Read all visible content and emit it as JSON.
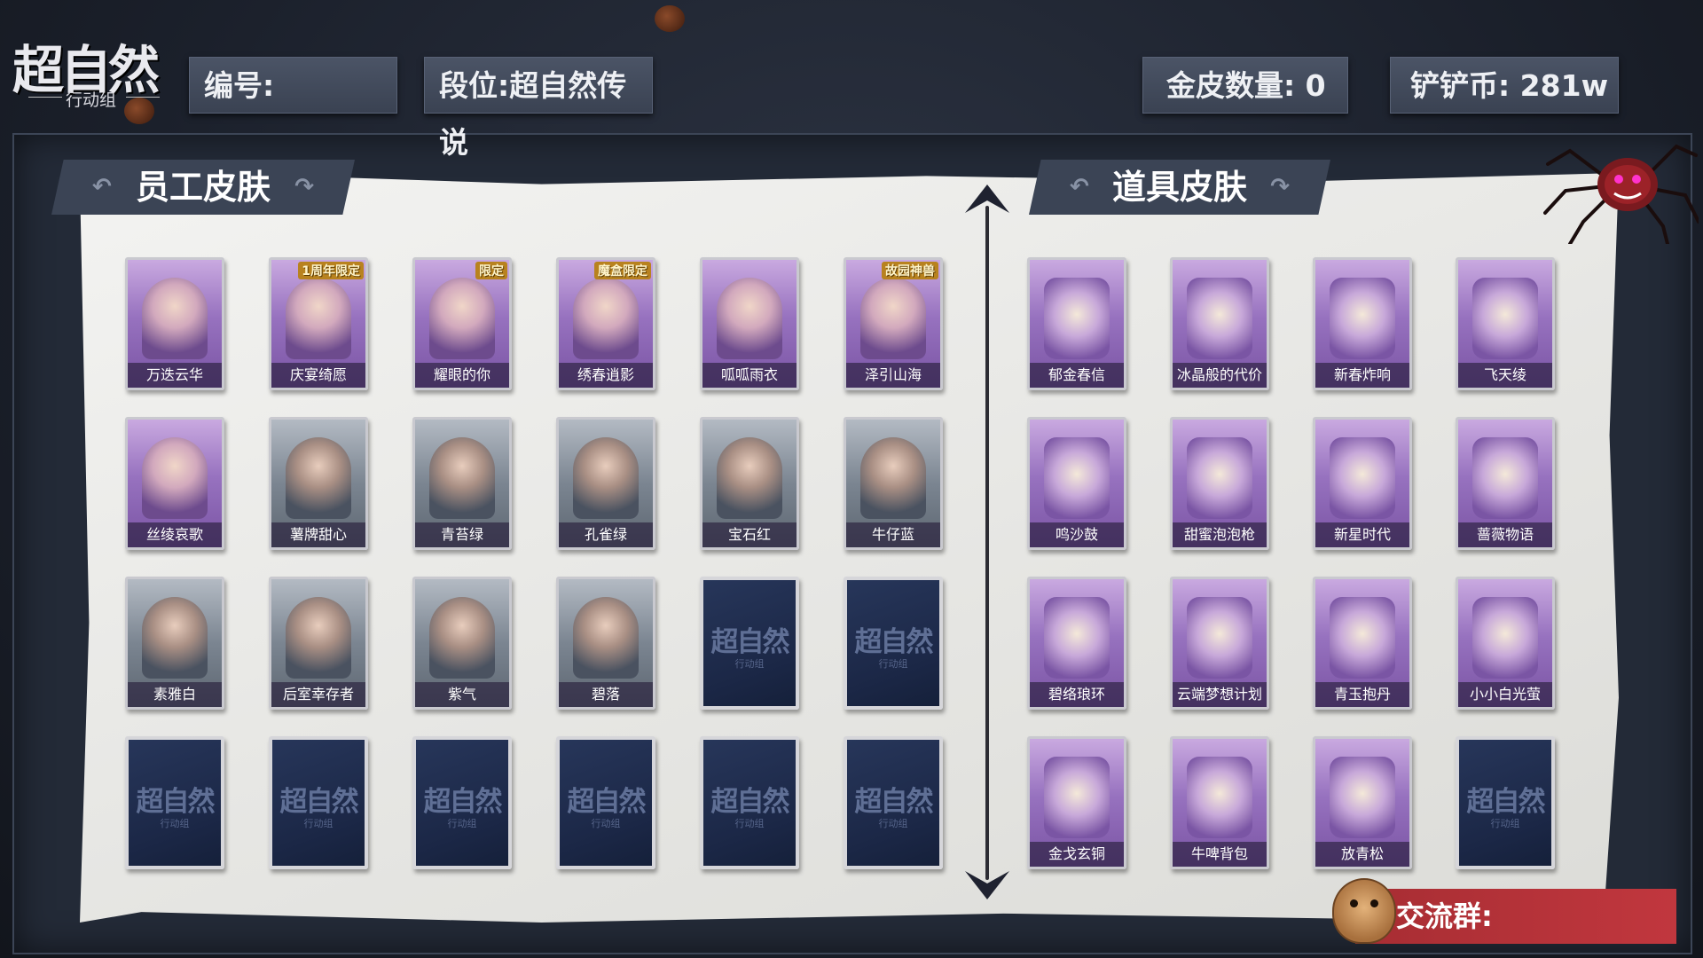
{
  "logo": {
    "main": "超自然",
    "sub": "行动组"
  },
  "stats": {
    "id_label": "编号:",
    "rank_label": "段位:超自然传说",
    "gold_label": "金皮数量: 0",
    "coin_label": "铲铲币: 281w"
  },
  "employee_section": {
    "title": "员工皮肤",
    "cards": [
      {
        "name": "万迭云华",
        "style": "purple",
        "badge": ""
      },
      {
        "name": "庆宴绮愿",
        "style": "purple",
        "badge": "1周年限定"
      },
      {
        "name": "耀眼的你",
        "style": "purple",
        "badge": "限定"
      },
      {
        "name": "绣春逍影",
        "style": "purple",
        "badge": "魔盒限定"
      },
      {
        "name": "呱呱雨衣",
        "style": "purple",
        "badge": ""
      },
      {
        "name": "泽引山海",
        "style": "purple",
        "badge": "故园神兽"
      },
      {
        "name": "丝绫哀歌",
        "style": "purple",
        "badge": ""
      },
      {
        "name": "薯牌甜心",
        "style": "gray",
        "badge": ""
      },
      {
        "name": "青苔绿",
        "style": "gray",
        "badge": ""
      },
      {
        "name": "孔雀绿",
        "style": "gray",
        "badge": ""
      },
      {
        "name": "宝石红",
        "style": "gray",
        "badge": ""
      },
      {
        "name": "牛仔蓝",
        "style": "gray",
        "badge": ""
      },
      {
        "name": "素雅白",
        "style": "gray",
        "badge": ""
      },
      {
        "name": "后室幸存者",
        "style": "gray",
        "badge": ""
      },
      {
        "name": "紫气",
        "style": "gray",
        "badge": ""
      },
      {
        "name": "碧落",
        "style": "gray",
        "badge": ""
      },
      {
        "name": "",
        "style": "locked",
        "badge": ""
      },
      {
        "name": "",
        "style": "locked",
        "badge": ""
      },
      {
        "name": "",
        "style": "locked",
        "badge": ""
      },
      {
        "name": "",
        "style": "locked",
        "badge": ""
      },
      {
        "name": "",
        "style": "locked",
        "badge": ""
      },
      {
        "name": "",
        "style": "locked",
        "badge": ""
      },
      {
        "name": "",
        "style": "locked",
        "badge": ""
      },
      {
        "name": "",
        "style": "locked",
        "badge": ""
      }
    ]
  },
  "item_section": {
    "title": "道具皮肤",
    "cards": [
      {
        "name": "郁金春信",
        "style": "purple",
        "badge": ""
      },
      {
        "name": "冰晶般的代价",
        "style": "purple",
        "badge": ""
      },
      {
        "name": "新春炸响",
        "style": "purple",
        "badge": ""
      },
      {
        "name": "飞天绫",
        "style": "purple",
        "badge": ""
      },
      {
        "name": "鸣沙鼓",
        "style": "purple",
        "badge": ""
      },
      {
        "name": "甜蜜泡泡枪",
        "style": "purple",
        "badge": ""
      },
      {
        "name": "新星时代",
        "style": "purple",
        "badge": ""
      },
      {
        "name": "蔷薇物语",
        "style": "purple",
        "badge": ""
      },
      {
        "name": "碧络琅环",
        "style": "purple",
        "badge": ""
      },
      {
        "name": "云端梦想计划",
        "style": "purple",
        "badge": ""
      },
      {
        "name": "青玉抱丹",
        "style": "purple",
        "badge": ""
      },
      {
        "name": "小小白光萤",
        "style": "purple",
        "badge": ""
      },
      {
        "name": "金戈玄铜",
        "style": "purple",
        "badge": ""
      },
      {
        "name": "牛啤背包",
        "style": "purple",
        "badge": ""
      },
      {
        "name": "放青松",
        "style": "purple",
        "badge": ""
      },
      {
        "name": "",
        "style": "locked",
        "badge": ""
      }
    ]
  },
  "locked_watermark": {
    "main": "超自然",
    "sub": "行动组"
  },
  "banner": {
    "label": "交流群:"
  },
  "colors": {
    "rare_purple": "#9772bf",
    "common_gray": "#7b8591",
    "locked_navy": "#1b2746",
    "banner_red": "#b8323a"
  }
}
